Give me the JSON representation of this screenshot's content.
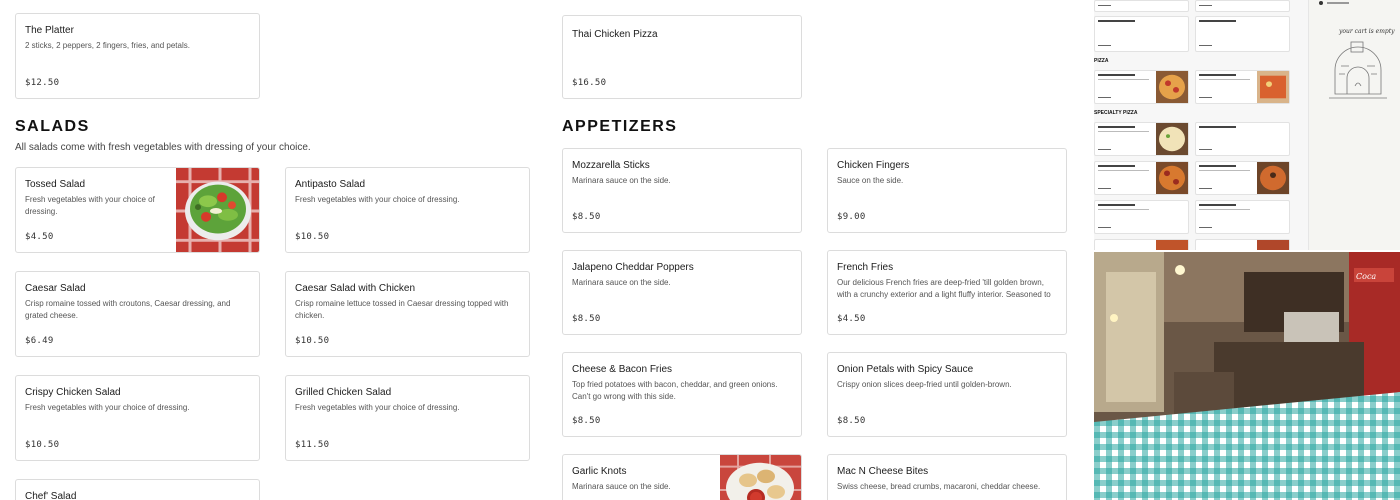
{
  "top_items": [
    {
      "name": "The Platter",
      "desc": "2 sticks, 2 peppers, 2 fingers, fries, and petals.",
      "price": "$12.50"
    },
    {
      "name": "Thai Chicken Pizza",
      "desc": "",
      "price": "$16.50"
    }
  ],
  "salads": {
    "title": "SALADS",
    "subtitle": "All salads come with fresh vegetables with dressing of your choice.",
    "items": [
      {
        "name": "Tossed Salad",
        "desc": "Fresh vegetables with your choice of dressing.",
        "price": "$4.50",
        "image": "tossed-salad-photo"
      },
      {
        "name": "Antipasto Salad",
        "desc": "Fresh vegetables with your choice of dressing.",
        "price": "$10.50"
      },
      {
        "name": "Caesar Salad",
        "desc": "Crisp romaine tossed with croutons, Caesar dressing, and grated cheese.",
        "price": "$6.49"
      },
      {
        "name": "Caesar Salad with Chicken",
        "desc": "Crisp romaine lettuce tossed in Caesar dressing topped with chicken.",
        "price": "$10.50"
      },
      {
        "name": "Crispy Chicken Salad",
        "desc": "Fresh vegetables with your choice of dressing.",
        "price": "$10.50"
      },
      {
        "name": "Grilled Chicken Salad",
        "desc": "Fresh vegetables with your choice of dressing.",
        "price": "$11.50"
      },
      {
        "name": "Chef' Salad",
        "desc": "",
        "price": ""
      }
    ]
  },
  "appetizers": {
    "title": "APPETIZERS",
    "items": [
      {
        "name": "Mozzarella Sticks",
        "desc": "Marinara sauce on the side.",
        "price": "$8.50"
      },
      {
        "name": "Chicken Fingers",
        "desc": "Sauce on the side.",
        "price": "$9.00"
      },
      {
        "name": "Jalapeno Cheddar Poppers",
        "desc": "Marinara sauce on the side.",
        "price": "$8.50"
      },
      {
        "name": "French Fries",
        "desc": "Our delicious French fries are deep-fried 'till golden brown, with a crunchy exterior and a light fluffy interior. Seasoned to",
        "price": "$4.50"
      },
      {
        "name": "Cheese & Bacon Fries",
        "desc": "Top fried potatoes with bacon, cheddar, and green onions. Can't go wrong with this side.",
        "price": "$8.50"
      },
      {
        "name": "Onion Petals with Spicy Sauce",
        "desc": "Crispy onion slices deep-fried until golden-brown.",
        "price": "$8.50"
      },
      {
        "name": "Garlic Knots",
        "desc": "Marinara sauce on the side.",
        "price": "",
        "image": "garlic-knots-photo"
      },
      {
        "name": "Mac N Cheese Bites",
        "desc": "Swiss cheese, bread crumbs, macaroni, cheddar cheese.",
        "price": ""
      }
    ]
  },
  "sidebar_preview": {
    "headings": [
      "PIZZA",
      "SPECIALTY PIZZA"
    ],
    "cart_empty_text": "your cart is empty"
  },
  "colors": {
    "accent": "#111111",
    "border": "#dcdcdc",
    "tablecloth": "#2aa6a0"
  }
}
